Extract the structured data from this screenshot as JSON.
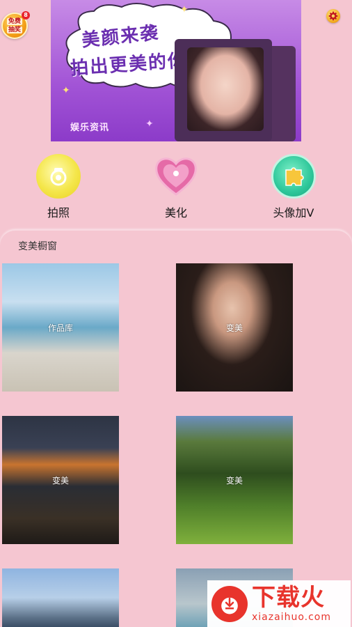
{
  "top_bar": {
    "lottery_line1": "免费",
    "lottery_line2": "抽奖",
    "lottery_count": "8"
  },
  "banner": {
    "line1": "美颜来袭",
    "line2": "拍出更美的你",
    "footer": "娱乐资讯"
  },
  "features": [
    {
      "label": "拍照",
      "icon": "camera-icon",
      "color": "#f6e84a"
    },
    {
      "label": "美化",
      "icon": "heart-icon",
      "color": "#e86aa8"
    },
    {
      "label": "头像加V",
      "icon": "puzzle-icon",
      "color": "#2ec79a"
    }
  ],
  "section": {
    "title": "变美橱窗",
    "tiles": [
      {
        "label": "作品库"
      },
      {
        "label": "变美"
      },
      {
        "label": "变美"
      },
      {
        "label": "变美"
      },
      {
        "label": ""
      },
      {
        "label": ""
      }
    ]
  },
  "watermark": {
    "main": "下载火",
    "sub": "xiazaihuo.com"
  }
}
